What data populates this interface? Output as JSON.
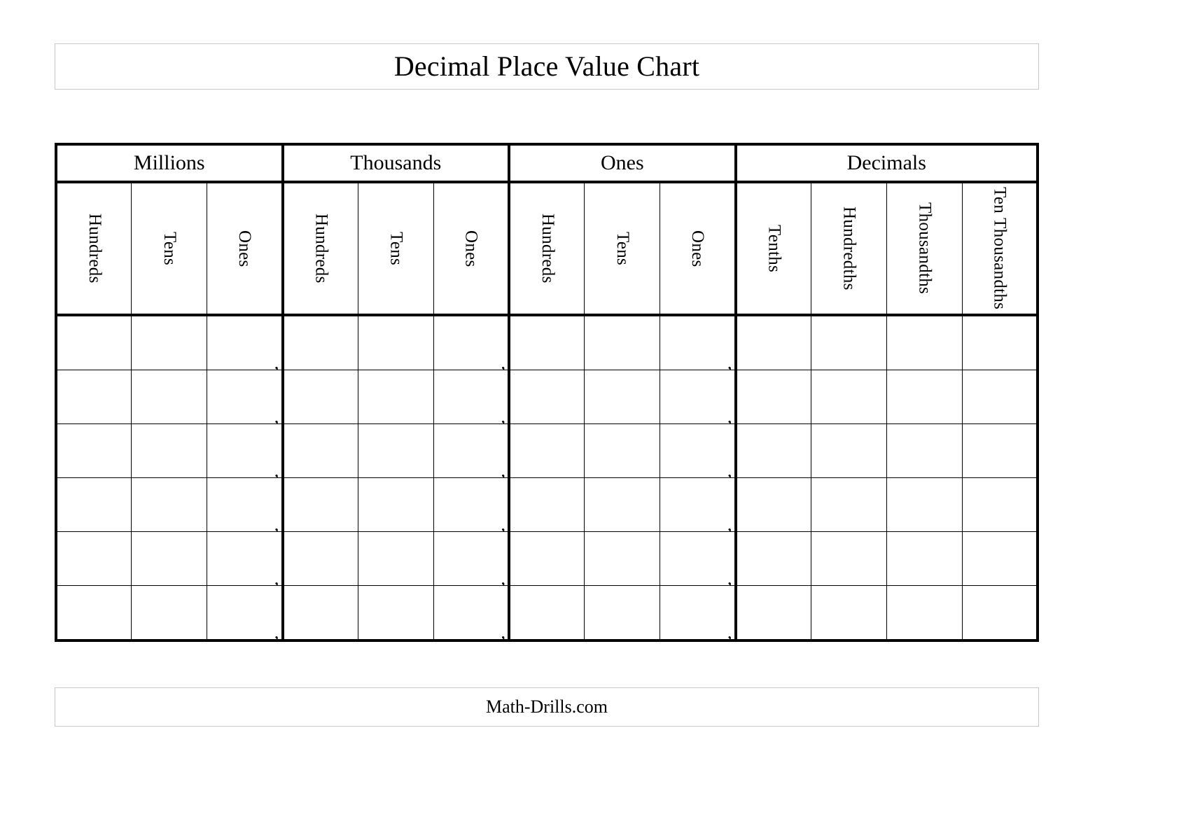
{
  "title": "Decimal Place Value Chart",
  "footer": "Math-Drills.com",
  "chart_data": {
    "type": "table",
    "title": "Decimal Place Value Chart",
    "groups": [
      {
        "label": "Millions",
        "span": 3
      },
      {
        "label": "Thousands",
        "span": 3
      },
      {
        "label": "Ones",
        "span": 3
      },
      {
        "label": "Decimals",
        "span": 4
      }
    ],
    "columns": [
      {
        "label": "Hundreds",
        "group": "Millions",
        "separator": ""
      },
      {
        "label": "Tens",
        "group": "Millions",
        "separator": ""
      },
      {
        "label": "Ones",
        "group": "Millions",
        "separator": ","
      },
      {
        "label": "Hundreds",
        "group": "Thousands",
        "separator": ""
      },
      {
        "label": "Tens",
        "group": "Thousands",
        "separator": ""
      },
      {
        "label": "Ones",
        "group": "Thousands",
        "separator": ","
      },
      {
        "label": "Hundreds",
        "group": "Ones",
        "separator": ""
      },
      {
        "label": "Tens",
        "group": "Ones",
        "separator": ""
      },
      {
        "label": "Ones",
        "group": "Ones",
        "separator": ","
      },
      {
        "label": "Tenths",
        "group": "Decimals",
        "separator": ""
      },
      {
        "label": "Hundredths",
        "group": "Decimals",
        "separator": ""
      },
      {
        "label": "Thousandths",
        "group": "Decimals",
        "separator": ""
      },
      {
        "label": "Ten Thousandths",
        "group": "Decimals",
        "separator": ""
      }
    ],
    "row_count": 6,
    "rows": [
      [
        "",
        "",
        "",
        "",
        "",
        "",
        "",
        "",
        "",
        "",
        "",
        "",
        ""
      ],
      [
        "",
        "",
        "",
        "",
        "",
        "",
        "",
        "",
        "",
        "",
        "",
        "",
        ""
      ],
      [
        "",
        "",
        "",
        "",
        "",
        "",
        "",
        "",
        "",
        "",
        "",
        "",
        ""
      ],
      [
        "",
        "",
        "",
        "",
        "",
        "",
        "",
        "",
        "",
        "",
        "",
        "",
        ""
      ],
      [
        "",
        "",
        "",
        "",
        "",
        "",
        "",
        "",
        "",
        "",
        "",
        "",
        ""
      ],
      [
        "",
        "",
        "",
        "",
        "",
        "",
        "",
        "",
        "",
        "",
        "",
        "",
        ""
      ]
    ],
    "grid": true,
    "legend": "none"
  },
  "colors": {
    "ink": "#000000",
    "banner_border": "#c9c9c9",
    "background": "#ffffff"
  }
}
